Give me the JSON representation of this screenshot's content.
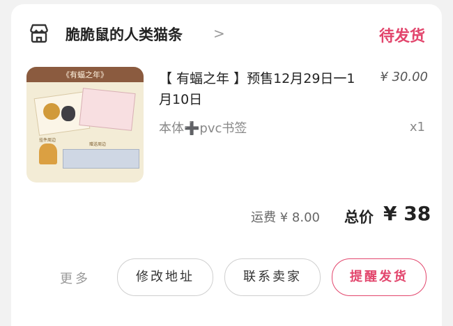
{
  "order": {
    "shop_name": "脆脆鼠的人类猫条",
    "chevron": ">",
    "status": "待发货",
    "item": {
      "thumb_title": "《有蝠之年》",
      "thumb_label_a": "挂件周边",
      "thumb_label_b": "赠送周边",
      "title": "【 有蝠之年 】预售12月29日一1月10日",
      "price": "¥ 30.00",
      "variant_main": "本体",
      "variant_plus": "➕",
      "variant_extra": "pvc书签",
      "quantity": "x1"
    },
    "shipping": "运费 ¥ 8.00",
    "total_label": "总价",
    "total_value": "¥ 38"
  },
  "actions": {
    "more": "更多",
    "change_address": "修改地址",
    "contact_seller": "联系卖家",
    "remind_ship": "提醒发货"
  },
  "colors": {
    "accent": "#e2456c",
    "background": "#f2f2f2"
  },
  "icons": {
    "shop": "shop-icon",
    "chevron": "chevron-right-icon"
  }
}
